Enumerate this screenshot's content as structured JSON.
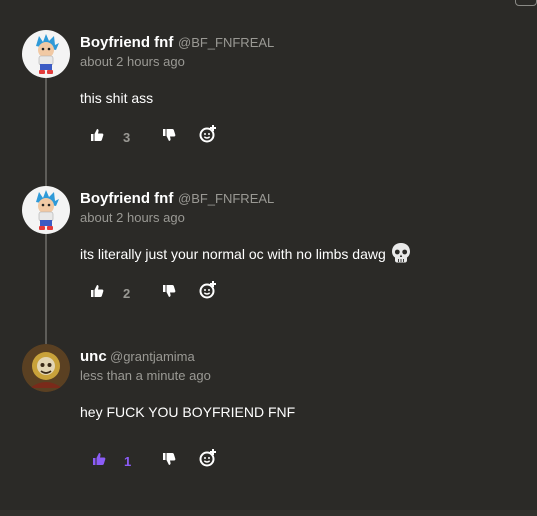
{
  "comments": [
    {
      "author": "Boyfriend fnf",
      "handle": "@BF_FNFREAL",
      "time": "about 2 hours ago",
      "text": "this shit ass",
      "likes": "3",
      "liked": false
    },
    {
      "author": "Boyfriend fnf",
      "handle": "@BF_FNFREAL",
      "time": "about 2 hours ago",
      "text": "its literally just your normal oc with no limbs dawg",
      "emoji_icon": "skull-icon",
      "likes": "2",
      "liked": false
    },
    {
      "author": "unc",
      "handle": "@grantjamima",
      "time": "less than a minute ago",
      "text": "hey FUCK YOU BOYFRIEND FNF",
      "likes": "1",
      "liked": true
    }
  ],
  "colors": {
    "background": "#2b2a27",
    "muted_text": "#9a9994",
    "accent": "#8b5cf6",
    "thread_line": "#5e5d59"
  }
}
